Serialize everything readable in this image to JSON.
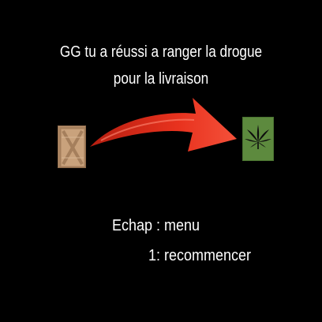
{
  "message": {
    "line1": "GG tu a réussi a ranger la drogue",
    "line2": "pour la livraison"
  },
  "icons": {
    "crate": "wooden-crate-icon",
    "arrow": "red-curved-arrow-icon",
    "weed": "cannabis-leaf-icon"
  },
  "controls": {
    "menu_hint": "Echap : menu",
    "restart_hint": "1: recommencer"
  },
  "colors": {
    "background": "#000000",
    "text": "#ffffff",
    "arrow": "#e8321e",
    "crate": "#c9a27c",
    "weed_tile": "#5d8a3e"
  }
}
